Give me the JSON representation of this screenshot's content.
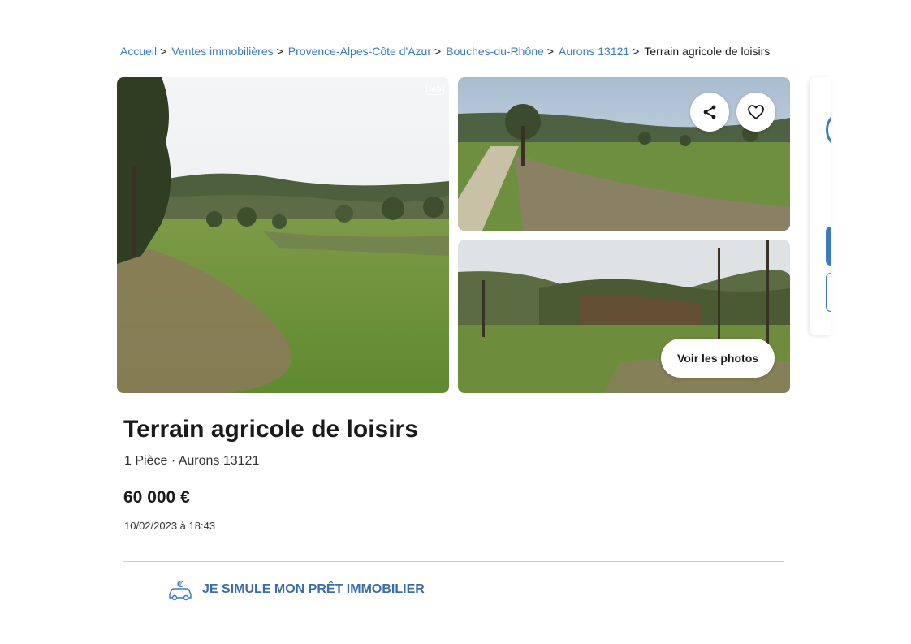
{
  "breadcrumb": {
    "items": [
      "Accueil",
      "Ventes immobilières",
      "Provence-Alpes-Côte d'Azur",
      "Bouches-du-Rhône",
      "Aurons 13121"
    ],
    "current": "Terrain agricole de loisirs",
    "separator": ">"
  },
  "gallery": {
    "watermark": "leb",
    "photos_button": "Voir les photos",
    "share_icon": "share-icon",
    "favorite_icon": "heart-icon"
  },
  "listing": {
    "title": "Terrain agricole de loisirs",
    "subtitle": "1 Pièce · Aurons 13121",
    "price": "60 000 €",
    "date": "10/02/2023 à 18:43"
  },
  "loan": {
    "label": "JE SIMULE MON PRÊT IMMOBILIER",
    "icon": "car-euro-icon"
  },
  "colors": {
    "link": "#3b7bc0",
    "loan": "#3b6ea8",
    "text": "#1a1a1a"
  }
}
